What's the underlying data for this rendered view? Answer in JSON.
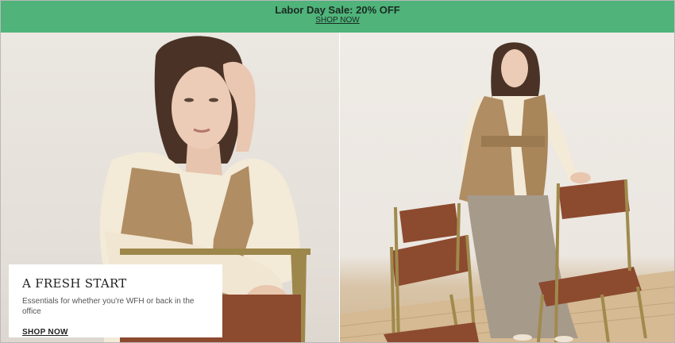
{
  "promo": {
    "title": "Labor Day Sale: 20% OFF",
    "link_label": "SHOP NOW"
  },
  "hero": {
    "title": "A FRESH START",
    "subtitle": "Essentials for whether you're WFH or back in the office",
    "link_label": "SHOP NOW"
  },
  "colors": {
    "promo_bg": "#4fb37a",
    "vest": "#b08d62",
    "chair_leather": "#8c4a2f",
    "chair_frame": "#a08a4c"
  }
}
